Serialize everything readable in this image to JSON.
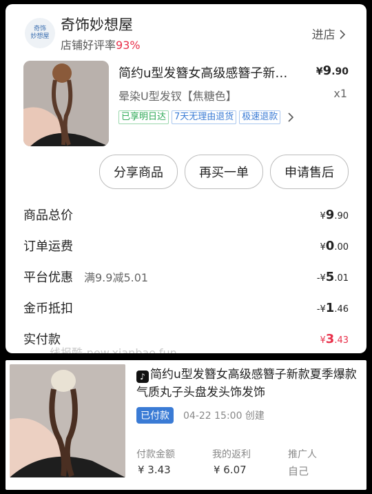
{
  "store": {
    "logo_line1": "奇饰",
    "logo_line2": "妙想屋",
    "name": "奇饰妙想屋",
    "rating_label": "店铺好评率",
    "rating_value": "93%",
    "enter_label": "进店"
  },
  "product": {
    "title": "简约u型发簪女高级感簪子新…",
    "price_symbol": "¥",
    "price_int": "9",
    "price_dec": ".90",
    "spec": "晕染U型发钗【焦糖色】",
    "qty": "x1",
    "tags": [
      "已享明日达",
      "7天无理由退货",
      "极速退款"
    ]
  },
  "actions": {
    "share": "分享商品",
    "rebuy": "再买一单",
    "aftersale": "申请售后"
  },
  "summary": {
    "total_label": "商品总价",
    "total_sym": "¥",
    "total_int": "9",
    "total_dec": ".90",
    "shipping_label": "订单运费",
    "shipping_sym": "¥",
    "shipping_int": "0",
    "shipping_dec": ".00",
    "discount_label": "平台优惠",
    "discount_note": "满9.9减5.01",
    "discount_sym": "-¥",
    "discount_int": "5",
    "discount_dec": ".01",
    "coin_label": "金币抵扣",
    "coin_sym": "-¥",
    "coin_int": "1",
    "coin_dec": ".46",
    "paid_label": "实付款",
    "paid_sym": "¥",
    "paid_int": "3",
    "paid_dec": ".43"
  },
  "watermark": "线报酷-new.xianbao.fun",
  "promo": {
    "title": "简约u型发簪女高级感簪子新款夏季爆款气质丸子头盘发头饰发饰",
    "status": "已付款",
    "time": "04-22 15:00 创建",
    "amount_label": "付款金额",
    "amount_value": "¥ 3.43",
    "rebate_label": "我的返利",
    "rebate_value": "¥ 6.07",
    "promoter_label": "推广人",
    "promoter_value": "自己"
  },
  "colors": {
    "price_red": "#e8304a",
    "badge_blue": "#3a7bd5",
    "tag_green": "#2eaa56"
  },
  "icons": [
    "chevron-right-icon",
    "douyin-icon"
  ]
}
